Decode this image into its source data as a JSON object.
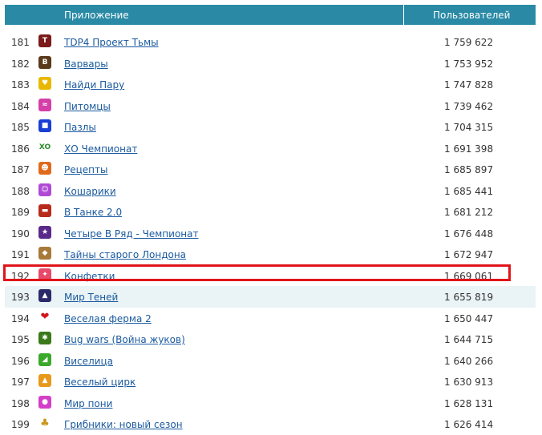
{
  "header": {
    "app_col": "Приложение",
    "users_col": "Пользователей"
  },
  "rows": [
    {
      "num": "181",
      "name": "TDP4 Проект Тьмы",
      "users": "1 759 622",
      "icon": "tdp4-icon",
      "color": "#7a1a1a",
      "glyph": "T"
    },
    {
      "num": "182",
      "name": "Варвары",
      "users": "1 753 952",
      "icon": "barbarian-icon",
      "color": "#5a3a1a",
      "glyph": "В"
    },
    {
      "num": "183",
      "name": "Найди Пару",
      "users": "1 747 828",
      "icon": "find-pair-icon",
      "color": "#e8b800",
      "glyph": "♥"
    },
    {
      "num": "184",
      "name": "Питомцы",
      "users": "1 739 462",
      "icon": "pets-icon",
      "color": "#d43fa8",
      "glyph": "≈"
    },
    {
      "num": "185",
      "name": "Пазлы",
      "users": "1 704 315",
      "icon": "puzzle-icon",
      "color": "#1a3fd4",
      "glyph": "■"
    },
    {
      "num": "186",
      "name": "ХО Чемпионат",
      "users": "1 691 398",
      "icon": "xo-icon",
      "color": "#ffffff",
      "glyph": "XO"
    },
    {
      "num": "187",
      "name": "Рецепты",
      "users": "1 685 897",
      "icon": "recipes-icon",
      "color": "#e06a1a",
      "glyph": "☻"
    },
    {
      "num": "188",
      "name": "Кошарики",
      "users": "1 685 441",
      "icon": "cat-balls-icon",
      "color": "#b04ad6",
      "glyph": "☺"
    },
    {
      "num": "189",
      "name": "В Танке 2.0",
      "users": "1 681 212",
      "icon": "tank-icon",
      "color": "#b82a1a",
      "glyph": "▬"
    },
    {
      "num": "190",
      "name": "Четыре В Ряд - Чемпионат",
      "users": "1 676 448",
      "icon": "four-in-row-icon",
      "color": "#5a2a8a",
      "glyph": "★"
    },
    {
      "num": "191",
      "name": "Тайны старого Лондона",
      "users": "1 672 947",
      "icon": "london-icon",
      "color": "#a87a3a",
      "glyph": "◆"
    },
    {
      "num": "192",
      "name": "Конфетки",
      "users": "1 669 061",
      "icon": "candy-icon",
      "color": "#e84a6a",
      "glyph": "✦"
    },
    {
      "num": "193",
      "name": "Мир Теней",
      "users": "1 655 819",
      "icon": "shadow-world-icon",
      "color": "#2a2a6a",
      "glyph": "▲"
    },
    {
      "num": "194",
      "name": "Веселая ферма 2",
      "users": "1 650 447",
      "icon": "heart-icon",
      "color": "#ffffff",
      "glyph": "❤"
    },
    {
      "num": "195",
      "name": "Bug wars (Война жуков)",
      "users": "1 644 715",
      "icon": "bug-icon",
      "color": "#3a7a1a",
      "glyph": "✱"
    },
    {
      "num": "196",
      "name": "Виселица",
      "users": "1 640 266",
      "icon": "hangman-icon",
      "color": "#3aa82a",
      "glyph": "◢"
    },
    {
      "num": "197",
      "name": "Веселый цирк",
      "users": "1 630 913",
      "icon": "circus-icon",
      "color": "#e8981a",
      "glyph": "▲"
    },
    {
      "num": "198",
      "name": "Мир пони",
      "users": "1 628 131",
      "icon": "pony-icon",
      "color": "#d43fc8",
      "glyph": "●"
    },
    {
      "num": "199",
      "name": "Грибники: новый сезон",
      "users": "1 626 414",
      "icon": "mushroom-icon",
      "color": "#ffffff",
      "glyph": "♣"
    }
  ],
  "highlight_color": "#e0141a",
  "alt_row_color": "#eaf3f5",
  "header_color": "#2a8aa6"
}
